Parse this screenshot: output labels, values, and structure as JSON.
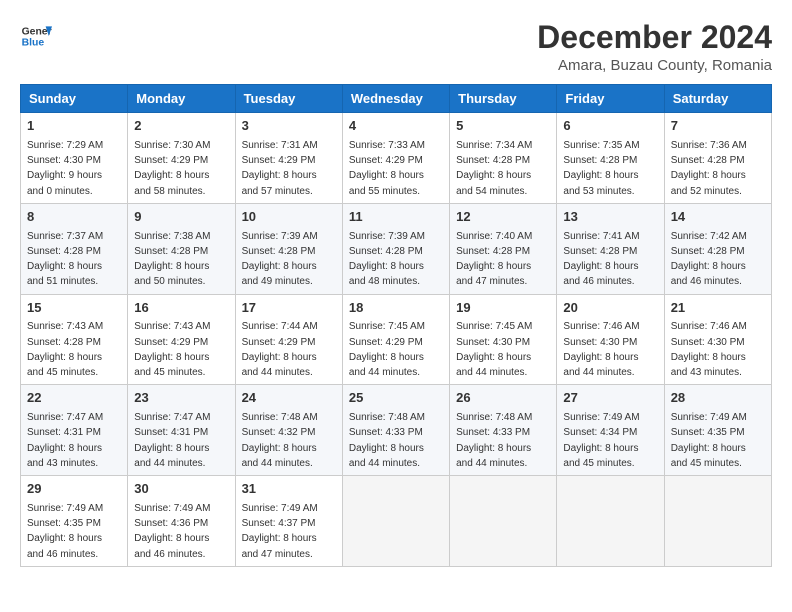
{
  "header": {
    "logo_line1": "General",
    "logo_line2": "Blue",
    "month_year": "December 2024",
    "location": "Amara, Buzau County, Romania"
  },
  "weekdays": [
    "Sunday",
    "Monday",
    "Tuesday",
    "Wednesday",
    "Thursday",
    "Friday",
    "Saturday"
  ],
  "weeks": [
    [
      {
        "day": "1",
        "sunrise": "Sunrise: 7:29 AM",
        "sunset": "Sunset: 4:30 PM",
        "daylight": "Daylight: 9 hours and 0 minutes."
      },
      {
        "day": "2",
        "sunrise": "Sunrise: 7:30 AM",
        "sunset": "Sunset: 4:29 PM",
        "daylight": "Daylight: 8 hours and 58 minutes."
      },
      {
        "day": "3",
        "sunrise": "Sunrise: 7:31 AM",
        "sunset": "Sunset: 4:29 PM",
        "daylight": "Daylight: 8 hours and 57 minutes."
      },
      {
        "day": "4",
        "sunrise": "Sunrise: 7:33 AM",
        "sunset": "Sunset: 4:29 PM",
        "daylight": "Daylight: 8 hours and 55 minutes."
      },
      {
        "day": "5",
        "sunrise": "Sunrise: 7:34 AM",
        "sunset": "Sunset: 4:28 PM",
        "daylight": "Daylight: 8 hours and 54 minutes."
      },
      {
        "day": "6",
        "sunrise": "Sunrise: 7:35 AM",
        "sunset": "Sunset: 4:28 PM",
        "daylight": "Daylight: 8 hours and 53 minutes."
      },
      {
        "day": "7",
        "sunrise": "Sunrise: 7:36 AM",
        "sunset": "Sunset: 4:28 PM",
        "daylight": "Daylight: 8 hours and 52 minutes."
      }
    ],
    [
      {
        "day": "8",
        "sunrise": "Sunrise: 7:37 AM",
        "sunset": "Sunset: 4:28 PM",
        "daylight": "Daylight: 8 hours and 51 minutes."
      },
      {
        "day": "9",
        "sunrise": "Sunrise: 7:38 AM",
        "sunset": "Sunset: 4:28 PM",
        "daylight": "Daylight: 8 hours and 50 minutes."
      },
      {
        "day": "10",
        "sunrise": "Sunrise: 7:39 AM",
        "sunset": "Sunset: 4:28 PM",
        "daylight": "Daylight: 8 hours and 49 minutes."
      },
      {
        "day": "11",
        "sunrise": "Sunrise: 7:39 AM",
        "sunset": "Sunset: 4:28 PM",
        "daylight": "Daylight: 8 hours and 48 minutes."
      },
      {
        "day": "12",
        "sunrise": "Sunrise: 7:40 AM",
        "sunset": "Sunset: 4:28 PM",
        "daylight": "Daylight: 8 hours and 47 minutes."
      },
      {
        "day": "13",
        "sunrise": "Sunrise: 7:41 AM",
        "sunset": "Sunset: 4:28 PM",
        "daylight": "Daylight: 8 hours and 46 minutes."
      },
      {
        "day": "14",
        "sunrise": "Sunrise: 7:42 AM",
        "sunset": "Sunset: 4:28 PM",
        "daylight": "Daylight: 8 hours and 46 minutes."
      }
    ],
    [
      {
        "day": "15",
        "sunrise": "Sunrise: 7:43 AM",
        "sunset": "Sunset: 4:28 PM",
        "daylight": "Daylight: 8 hours and 45 minutes."
      },
      {
        "day": "16",
        "sunrise": "Sunrise: 7:43 AM",
        "sunset": "Sunset: 4:29 PM",
        "daylight": "Daylight: 8 hours and 45 minutes."
      },
      {
        "day": "17",
        "sunrise": "Sunrise: 7:44 AM",
        "sunset": "Sunset: 4:29 PM",
        "daylight": "Daylight: 8 hours and 44 minutes."
      },
      {
        "day": "18",
        "sunrise": "Sunrise: 7:45 AM",
        "sunset": "Sunset: 4:29 PM",
        "daylight": "Daylight: 8 hours and 44 minutes."
      },
      {
        "day": "19",
        "sunrise": "Sunrise: 7:45 AM",
        "sunset": "Sunset: 4:30 PM",
        "daylight": "Daylight: 8 hours and 44 minutes."
      },
      {
        "day": "20",
        "sunrise": "Sunrise: 7:46 AM",
        "sunset": "Sunset: 4:30 PM",
        "daylight": "Daylight: 8 hours and 44 minutes."
      },
      {
        "day": "21",
        "sunrise": "Sunrise: 7:46 AM",
        "sunset": "Sunset: 4:30 PM",
        "daylight": "Daylight: 8 hours and 43 minutes."
      }
    ],
    [
      {
        "day": "22",
        "sunrise": "Sunrise: 7:47 AM",
        "sunset": "Sunset: 4:31 PM",
        "daylight": "Daylight: 8 hours and 43 minutes."
      },
      {
        "day": "23",
        "sunrise": "Sunrise: 7:47 AM",
        "sunset": "Sunset: 4:31 PM",
        "daylight": "Daylight: 8 hours and 44 minutes."
      },
      {
        "day": "24",
        "sunrise": "Sunrise: 7:48 AM",
        "sunset": "Sunset: 4:32 PM",
        "daylight": "Daylight: 8 hours and 44 minutes."
      },
      {
        "day": "25",
        "sunrise": "Sunrise: 7:48 AM",
        "sunset": "Sunset: 4:33 PM",
        "daylight": "Daylight: 8 hours and 44 minutes."
      },
      {
        "day": "26",
        "sunrise": "Sunrise: 7:48 AM",
        "sunset": "Sunset: 4:33 PM",
        "daylight": "Daylight: 8 hours and 44 minutes."
      },
      {
        "day": "27",
        "sunrise": "Sunrise: 7:49 AM",
        "sunset": "Sunset: 4:34 PM",
        "daylight": "Daylight: 8 hours and 45 minutes."
      },
      {
        "day": "28",
        "sunrise": "Sunrise: 7:49 AM",
        "sunset": "Sunset: 4:35 PM",
        "daylight": "Daylight: 8 hours and 45 minutes."
      }
    ],
    [
      {
        "day": "29",
        "sunrise": "Sunrise: 7:49 AM",
        "sunset": "Sunset: 4:35 PM",
        "daylight": "Daylight: 8 hours and 46 minutes."
      },
      {
        "day": "30",
        "sunrise": "Sunrise: 7:49 AM",
        "sunset": "Sunset: 4:36 PM",
        "daylight": "Daylight: 8 hours and 46 minutes."
      },
      {
        "day": "31",
        "sunrise": "Sunrise: 7:49 AM",
        "sunset": "Sunset: 4:37 PM",
        "daylight": "Daylight: 8 hours and 47 minutes."
      },
      null,
      null,
      null,
      null
    ]
  ]
}
